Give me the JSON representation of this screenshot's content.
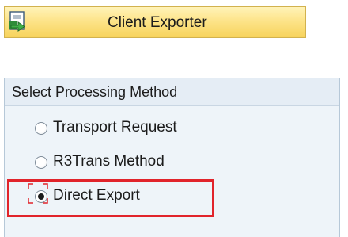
{
  "toolbar": {
    "exporter_label": "Client Exporter",
    "exporter_icon": "export-document-icon"
  },
  "processing_method": {
    "title": "Select Processing Method",
    "options": [
      {
        "label": "Transport Request",
        "selected": false
      },
      {
        "label": "R3Trans Method",
        "selected": false
      },
      {
        "label": "Direct Export",
        "selected": true
      }
    ]
  },
  "annotation": {
    "highlight_color": "#e1242b"
  }
}
